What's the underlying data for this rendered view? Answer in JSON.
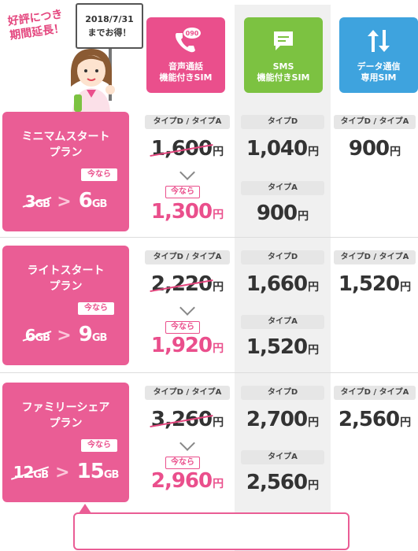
{
  "header": {
    "promo_line1": "好評につき",
    "promo_line2": "期間延長！",
    "sign_line1": "2018/7/31",
    "sign_line2": "までお得！",
    "sim_types": [
      {
        "line1": "音声通話",
        "line2": "機能付きSIM",
        "icon": "phone-icon",
        "color": "#ea4f8c"
      },
      {
        "line1": "SMS",
        "line2": "機能付きSIM",
        "icon": "chat-bubble-icon",
        "color": "#7cc241"
      },
      {
        "line1": "データ通信",
        "line2": "専用SIM",
        "icon": "updown-arrows-icon",
        "color": "#3ea3de"
      }
    ],
    "phone_icon_badge": "090"
  },
  "plans": [
    {
      "name_line1": "ミニマムスタート",
      "name_line2": "プラン",
      "now_label": "今なら",
      "old_gb": "3",
      "new_gb": "6",
      "gb_unit": "GB",
      "voice": {
        "type_label": "タイプD / タイプA",
        "old_price": "1,600",
        "now_label": "今なら",
        "new_price": "1,300",
        "yen": "円"
      },
      "sms": [
        {
          "type_label": "タイプD",
          "price": "1,040",
          "yen": "円"
        },
        {
          "type_label": "タイプA",
          "price": "900",
          "yen": "円"
        }
      ],
      "data": {
        "type_label": "タイプD / タイプA",
        "price": "900",
        "yen": "円"
      }
    },
    {
      "name_line1": "ライトスタート",
      "name_line2": "プラン",
      "now_label": "今なら",
      "old_gb": "6",
      "new_gb": "9",
      "gb_unit": "GB",
      "voice": {
        "type_label": "タイプD / タイプA",
        "old_price": "2,220",
        "now_label": "今なら",
        "new_price": "1,920",
        "yen": "円"
      },
      "sms": [
        {
          "type_label": "タイプD",
          "price": "1,660",
          "yen": "円"
        },
        {
          "type_label": "タイプA",
          "price": "1,520",
          "yen": "円"
        }
      ],
      "data": {
        "type_label": "タイプD / タイプA",
        "price": "1,520",
        "yen": "円"
      }
    },
    {
      "name_line1": "ファミリーシェア",
      "name_line2": "プラン",
      "now_label": "今なら",
      "old_gb": "12",
      "new_gb": "15",
      "gb_unit": "GB",
      "voice": {
        "type_label": "タイプD / タイプA",
        "old_price": "3,260",
        "now_label": "今なら",
        "new_price": "2,960",
        "yen": "円"
      },
      "sms": [
        {
          "type_label": "タイプD",
          "price": "2,700",
          "yen": "円"
        },
        {
          "type_label": "タイプA",
          "price": "2,560",
          "yen": "円"
        }
      ],
      "data": {
        "type_label": "タイプD / タイプA",
        "price": "2,560",
        "yen": "円"
      }
    }
  ],
  "colors": {
    "pink": "#ea4f8c",
    "green": "#7cc241",
    "blue": "#3ea3de"
  }
}
